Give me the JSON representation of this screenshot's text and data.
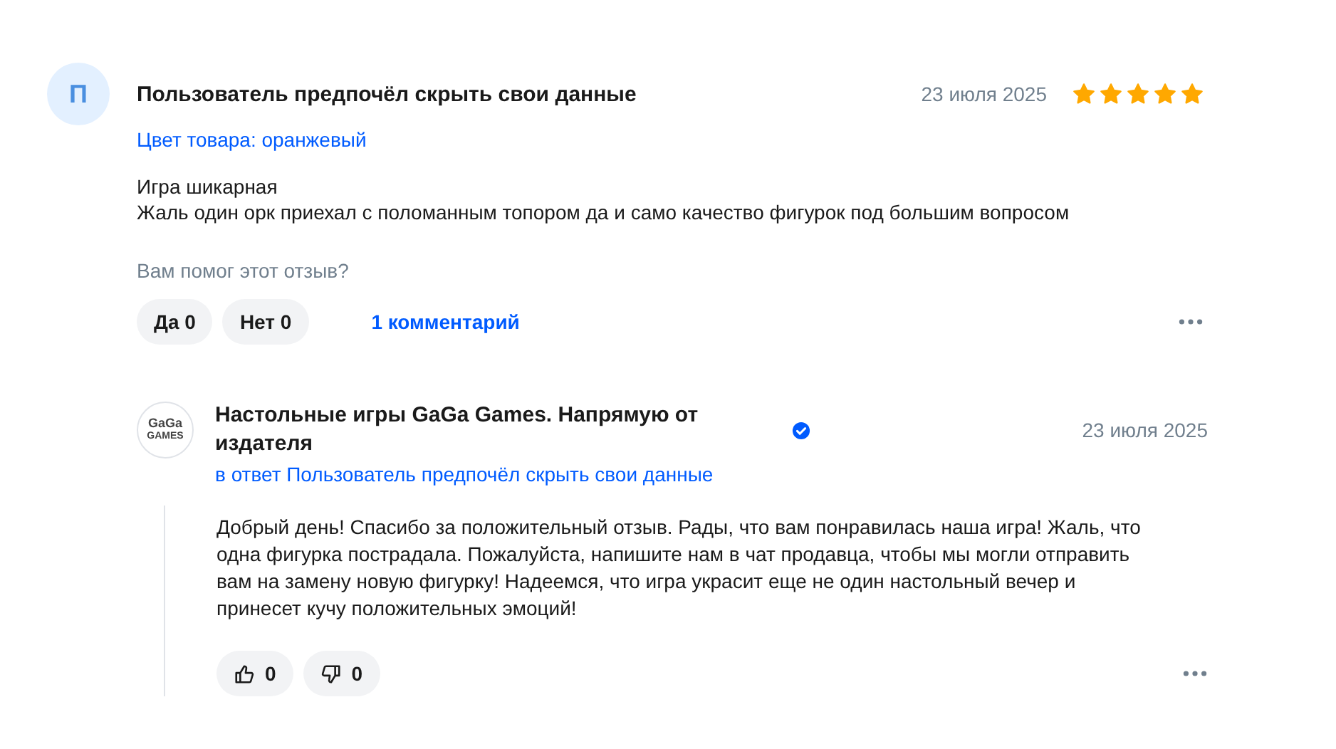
{
  "review": {
    "avatar_letter": "П",
    "author": "Пользователь предпочёл скрыть свои данные",
    "date": "23 июля 2025",
    "stars": 5,
    "product_color": "Цвет товара: оранжевый",
    "text": [
      "Игра шикарная",
      "Жаль один орк приехал с поломанным топором да и само качество фигурок под большим вопросом"
    ],
    "helpful_question": "Вам помог этот отзыв?",
    "yes_button": "Да 0",
    "no_button": "Нет 0",
    "comments_link": "1 комментарий"
  },
  "reply": {
    "logo": {
      "top": "GaGa",
      "bottom": "GAMES"
    },
    "author": "Настольные игры GaGa Games. Напрямую от издателя",
    "verified": true,
    "date": "23 июля 2025",
    "in_reply_to": "в ответ Пользователь предпочёл скрыть свои данные",
    "text": "Добрый день! Спасибо за положительный отзыв. Рады, что вам понравилась наша игра! Жаль, что одна фигурка пострадала. Пожалуйста, напишите нам в чат продавца, чтобы мы могли отправить вам на замену новую фигурку! Надеемся, что игра украсит еще не один настольный вечер и принесет кучу положительных эмоций!",
    "likes": "0",
    "dislikes": "0"
  }
}
